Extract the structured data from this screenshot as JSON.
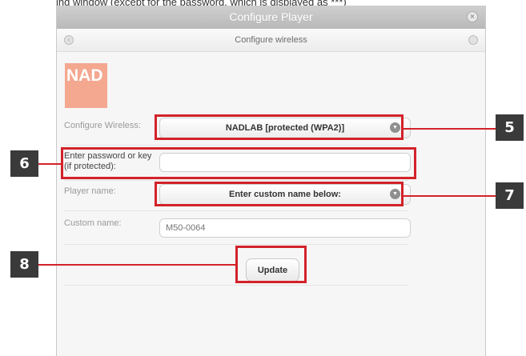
{
  "doc_text": "ing window (except for the password, which is displayed as ***)",
  "window": {
    "title": "Configure Player",
    "subtitle": "Configure wireless"
  },
  "logo": {
    "text": "NAD"
  },
  "form": {
    "wireless_label": "Configure Wireless:",
    "wireless_value": "NADLAB [protected (WPA2)]",
    "password_label": "Enter password or key (if protected):",
    "password_value": "",
    "player_name_label": "Player name:",
    "player_name_value": "Enter custom name below:",
    "custom_name_label": "Custom name:",
    "custom_name_placeholder": "M50-0064",
    "update_label": "Update"
  },
  "callouts": [
    "5",
    "6",
    "7",
    "8"
  ],
  "colors": {
    "callout": "#d3222a",
    "badge": "#3a3a3a",
    "logo": "#f4a890"
  },
  "icons": {
    "close": "close-circle-icon",
    "select": "chevron-down-circle-icon",
    "sub_left": "circle-icon",
    "sub_right": "circle-icon"
  }
}
